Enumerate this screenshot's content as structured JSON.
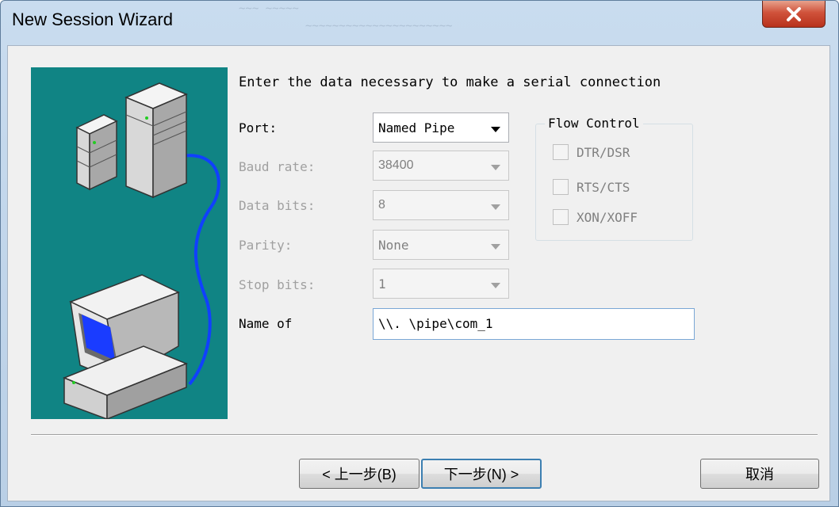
{
  "window": {
    "title": "New Session Wizard"
  },
  "header": {
    "instruction": "Enter the data necessary to make a serial connection"
  },
  "fields": {
    "port": {
      "label": "Port:",
      "value": "Named Pipe"
    },
    "baud_rate": {
      "label": "Baud rate:",
      "value": "38400"
    },
    "data_bits": {
      "label": "Data bits:",
      "value": "8"
    },
    "parity": {
      "label": "Parity:",
      "value": "None"
    },
    "stop_bits": {
      "label": "Stop bits:",
      "value": "1"
    },
    "name_of": {
      "label": "Name of",
      "value": "\\\\. \\pipe\\com_1"
    }
  },
  "flow_control": {
    "title": "Flow Control",
    "options": [
      {
        "label": "DTR/DSR",
        "checked": false
      },
      {
        "label": "RTS/CTS",
        "checked": false
      },
      {
        "label": "XON/XOFF",
        "checked": false
      }
    ]
  },
  "buttons": {
    "back": "< 上一步(B)",
    "next": "下一步(N) >",
    "cancel": "取消"
  },
  "icons": {
    "close": "close-icon",
    "illustration": "servers-and-computer-illustration"
  },
  "colors": {
    "illustration_bg": "#108484",
    "title_bar": "#c9dcef",
    "close_button": "#c94a33"
  }
}
